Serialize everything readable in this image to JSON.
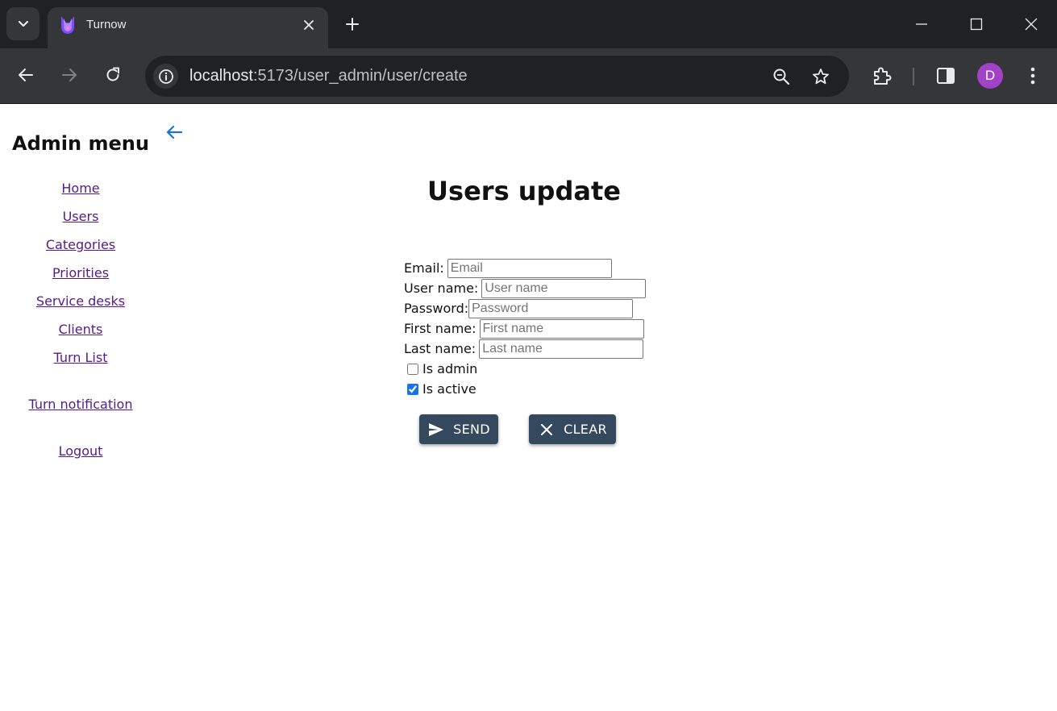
{
  "browser": {
    "tab": {
      "title": "Turnow"
    },
    "address_bar": {
      "host": "localhost",
      "path": ":5173/user_admin/user/create"
    },
    "profile_initial": "D"
  },
  "sidebar": {
    "title": "Admin menu",
    "items": [
      {
        "label": "Home"
      },
      {
        "label": "Users"
      },
      {
        "label": "Categories"
      },
      {
        "label": "Priorities"
      },
      {
        "label": "Service desks"
      },
      {
        "label": "Clients"
      },
      {
        "label": "Turn List"
      },
      {
        "label": "Turn notification"
      },
      {
        "label": "Logout"
      }
    ]
  },
  "main": {
    "title": "Users update",
    "form": {
      "email": {
        "label": "Email:",
        "placeholder": "Email",
        "value": ""
      },
      "username": {
        "label": "User name:",
        "placeholder": "User name",
        "value": ""
      },
      "password": {
        "label": "Password:",
        "placeholder": "Password",
        "value": ""
      },
      "first_name": {
        "label": "First name:",
        "placeholder": "First name",
        "value": ""
      },
      "last_name": {
        "label": "Last name:",
        "placeholder": "Last name",
        "value": ""
      },
      "is_admin": {
        "label": "Is admin",
        "checked": false
      },
      "is_active": {
        "label": "Is active",
        "checked": true
      }
    },
    "buttons": {
      "send": "SEND",
      "clear": "CLEAR"
    }
  },
  "colors": {
    "button_bg": "#34495e",
    "link": "#551a8b",
    "back_arrow": "#1976d2",
    "avatar": "#a142c9"
  },
  "icons": {
    "tab_search": "chevron-down-icon",
    "favicon": "turnow-logo-icon",
    "back": "arrow-left-icon",
    "send": "send-icon",
    "clear": "close-icon"
  }
}
